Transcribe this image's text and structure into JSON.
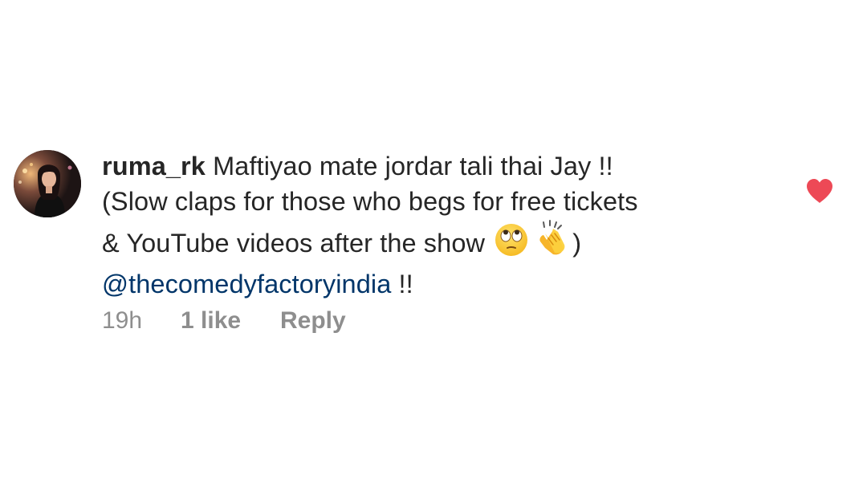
{
  "comment": {
    "username": "ruma_rk",
    "text_line1": "Maftiyao mate jordar tali thai Jay !!",
    "text_line2": "(Slow claps for those who begs for free tickets",
    "text_line3_before": "& YouTube videos after the show",
    "emoji_1": "face-with-rolling-eyes-icon",
    "emoji_2": "clapping-hands-icon",
    "text_line3_after": ")",
    "mention": "@thecomedyfactoryindia",
    "text_line4_after": " !!",
    "time": "19h",
    "likes": "1 like",
    "reply": "Reply",
    "liked": true
  },
  "colors": {
    "text": "#262626",
    "secondary": "#8e8e8e",
    "mention": "#003569",
    "heart": "#ed4956",
    "background": "#ffffff"
  }
}
